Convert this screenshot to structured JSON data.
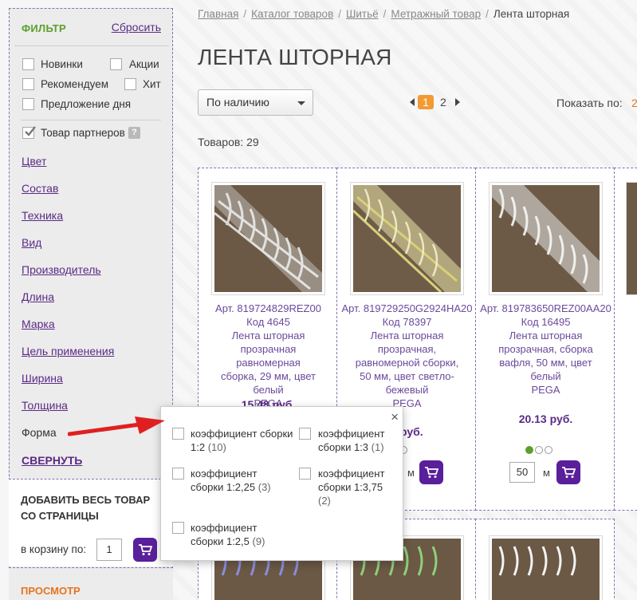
{
  "filter": {
    "title": "ФИЛЬТР",
    "reset": "Сбросить",
    "checks": [
      {
        "label": "Новинки",
        "checked": false
      },
      {
        "label": "Акции",
        "checked": false
      },
      {
        "label": "Рекомендуем",
        "checked": false
      },
      {
        "label": "Хит",
        "checked": false
      },
      {
        "label": "Предложение дня",
        "checked": false
      }
    ],
    "partners": {
      "label": "Товар партнеров",
      "checked": true,
      "help": "?"
    },
    "links": [
      "Цвет",
      "Состав",
      "Техника",
      "Вид",
      "Производитель",
      "Длина",
      "Марка",
      "Цель применения",
      "Ширина",
      "Толщина"
    ],
    "forma": "Форма",
    "collapse": "СВЕРНУТЬ"
  },
  "add_all": {
    "title": "ДОБАВИТЬ ВЕСЬ ТОВАР СО СТРАНИЦЫ",
    "label": "в корзину по:",
    "qty": "1"
  },
  "view": {
    "title": "ПРОСМОТР"
  },
  "breadcrumbs": [
    "Главная",
    "Каталог товаров",
    "Шитьё",
    "Метражный товар"
  ],
  "breadcrumb_current": "Лента шторная",
  "page_title": "ЛЕНТА ШТОРНАЯ",
  "sort": {
    "value": "По наличию"
  },
  "pager": {
    "current": "1",
    "next": "2"
  },
  "show_by": {
    "label": "Показать по:",
    "value": "2"
  },
  "count": "Товаров: 29",
  "products": [
    {
      "art": "Арт. 819724829REZ00",
      "code": "Код 4645",
      "name": "Лента шторная прозрачная равномерная сборка, 29 мм, цвет белый",
      "brand": "PEGA",
      "price": "15.48 руб.",
      "tint": "white"
    },
    {
      "art": "Арт. 819729250G2924HA20",
      "code": "Код 78397",
      "name": "Лента шторная прозрачная, равномерной сборки, 50 мм, цвет светло-бежевый",
      "brand": "PEGA",
      "price": "8 руб.",
      "tint": "yellow"
    },
    {
      "art": "Арт. 819783650REZ00AA20",
      "code": "Код 16495",
      "name": "Лента шторная прозрачная, сборка вафля, 50 мм, цвет белый",
      "brand": "PEGA",
      "price": "20.13 руб.",
      "tint": "white",
      "qty": "50",
      "unit": "м"
    }
  ],
  "unit_m": "м",
  "popup": {
    "close": "×",
    "options": [
      {
        "label": "коэффициент сборки 1:2",
        "count": "(10)"
      },
      {
        "label": "коэффициент сборки 1:3",
        "count": "(1)"
      },
      {
        "label": "коэффициент сборки 1:2,25",
        "count": "(3)"
      },
      {
        "label": "коэффициент сборки 1:3,75",
        "count": "(2)"
      },
      {
        "label": "коэффициент сборки 1:2,5",
        "count": "(9)"
      }
    ]
  },
  "colors": {
    "accent_purple": "#5a1f9a",
    "green": "#5aa02c",
    "orange": "#f39a32",
    "arrow_red": "#e02020"
  }
}
